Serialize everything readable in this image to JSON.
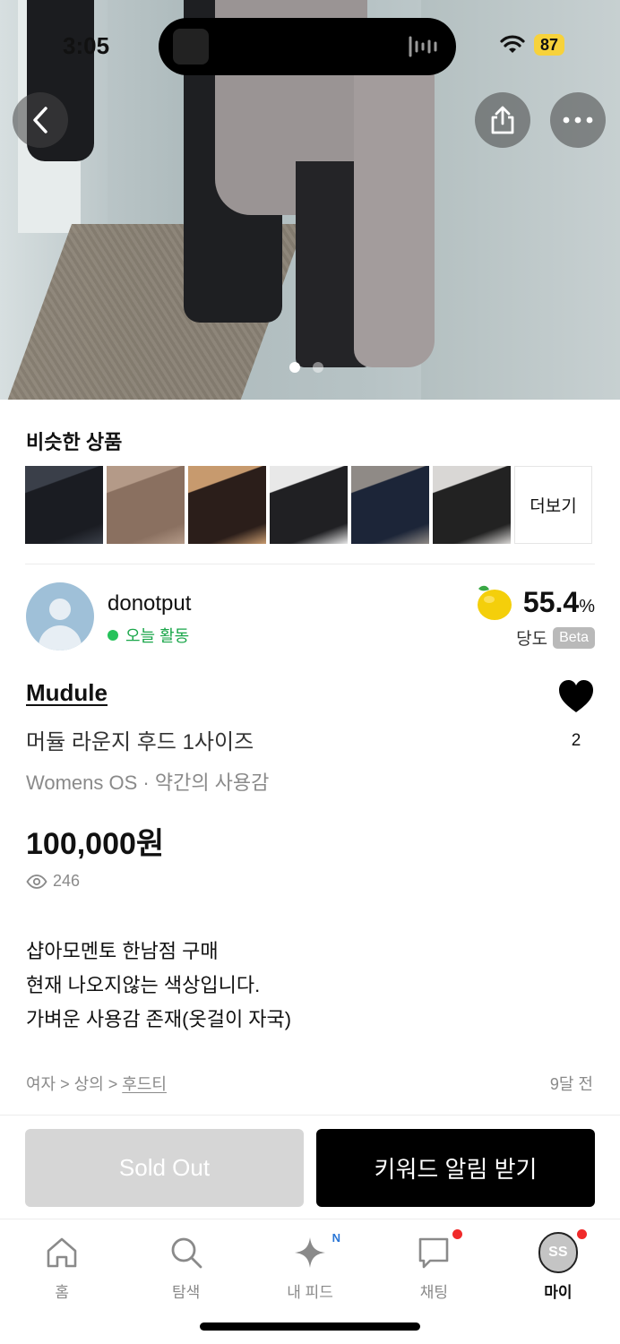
{
  "status_bar": {
    "time": "3:05",
    "battery": "87"
  },
  "hero": {
    "page_count": 2,
    "active_page": 1
  },
  "similar": {
    "title": "비슷한 상품",
    "more_label": "더보기",
    "thumbnails": [
      {
        "icon": "black-shirt-photo",
        "colors": [
          "#1a1c22",
          "#3a3f49"
        ]
      },
      {
        "icon": "tan-jacket-photo",
        "colors": [
          "#8a7060",
          "#b49a88"
        ]
      },
      {
        "icon": "patterned-cardigan-photo",
        "colors": [
          "#2b1e1a",
          "#c79a6e"
        ]
      },
      {
        "icon": "black-coat-photo",
        "colors": [
          "#202023",
          "#e8e8e8"
        ]
      },
      {
        "icon": "navy-coat-photo",
        "colors": [
          "#1c2538",
          "#8f8a86"
        ]
      },
      {
        "icon": "lace-dress-photo",
        "colors": [
          "#222",
          "#d9d7d5"
        ]
      }
    ]
  },
  "seller": {
    "name": "donotput",
    "activity": "오늘 활동",
    "score": "55.4",
    "score_unit": "%",
    "score_label": "당도",
    "beta_label": "Beta"
  },
  "product": {
    "brand": "Mudule",
    "title": "머듈 라운지 후드 1사이즈",
    "meta": "Womens OS · 약간의 사용감",
    "price": "100,000원",
    "views": "246",
    "likes": "2",
    "description": [
      "샵아모멘토 한남점 구매",
      "현재 나오지않는 색상입니다.",
      "가벼운 사용감 존재(옷걸이 자국)"
    ],
    "category_prefix": "여자 > 상의 > ",
    "category_leaf": "후드티",
    "time_ago": "9달 전"
  },
  "actions": {
    "sold_out": "Sold Out",
    "keyword_alert": "키워드 알림 받기"
  },
  "tabbar": {
    "home": "홈",
    "search": "탐색",
    "feed": "내 피드",
    "feed_badge": "N",
    "chat": "채팅",
    "my": "마이",
    "my_initials": "SS"
  },
  "colors": {
    "accent": "#000000",
    "activity_green": "#26c25b",
    "sold_out_gray": "#d6d6d6",
    "notification_red": "#f02a2a"
  }
}
